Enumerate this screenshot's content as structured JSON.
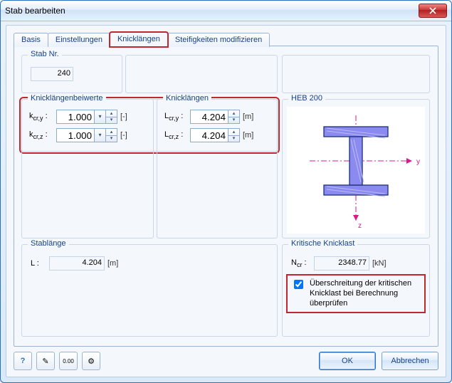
{
  "window": {
    "title": "Stab bearbeiten"
  },
  "tabs": [
    "Basis",
    "Einstellungen",
    "Knicklängen",
    "Steifigkeiten modifizieren"
  ],
  "stab_nr": {
    "caption": "Stab Nr.",
    "value": "240"
  },
  "klb": {
    "caption": "Knicklängenbeiwerte",
    "kcry_label": "k",
    "kcry_sub": "cr,y",
    "kcry_suffix": " :",
    "kcry_value": "1.000",
    "kcry_unit": "[-]",
    "kcrz_label": "k",
    "kcrz_sub": "cr,z",
    "kcrz_suffix": " :",
    "kcrz_value": "1.000",
    "kcrz_unit": "[-]"
  },
  "kl": {
    "caption": "Knicklängen",
    "lcry_label": "L",
    "lcry_sub": "cr,y",
    "lcry_suffix": " :",
    "lcry_value": "4.204",
    "lcry_unit": "[m]",
    "lcrz_label": "L",
    "lcrz_sub": "cr,z",
    "lcrz_suffix": " :",
    "lcrz_value": "4.204",
    "lcrz_unit": "[m]"
  },
  "section": {
    "name": "HEB 200",
    "axes": {
      "y": "y",
      "z": "z"
    }
  },
  "stablange": {
    "caption": "Stablänge",
    "L_label": "L :",
    "L_value": "4.204",
    "L_unit": "[m]"
  },
  "kkl": {
    "caption": "Kritische Knicklast",
    "Ncr_label": "N",
    "Ncr_sub": "cr",
    "Ncr_suffix": " :",
    "Ncr_value": "2348.77",
    "Ncr_unit": "[kN]",
    "check_label": "Überschreitung der kritischen Knicklast bei Berechnung überprüfen",
    "check_value": true
  },
  "buttons": {
    "ok": "OK",
    "cancel": "Abbrechen"
  },
  "icons": {
    "help": "?",
    "edit": "✎",
    "units": "0.00",
    "opts": "⚙"
  }
}
